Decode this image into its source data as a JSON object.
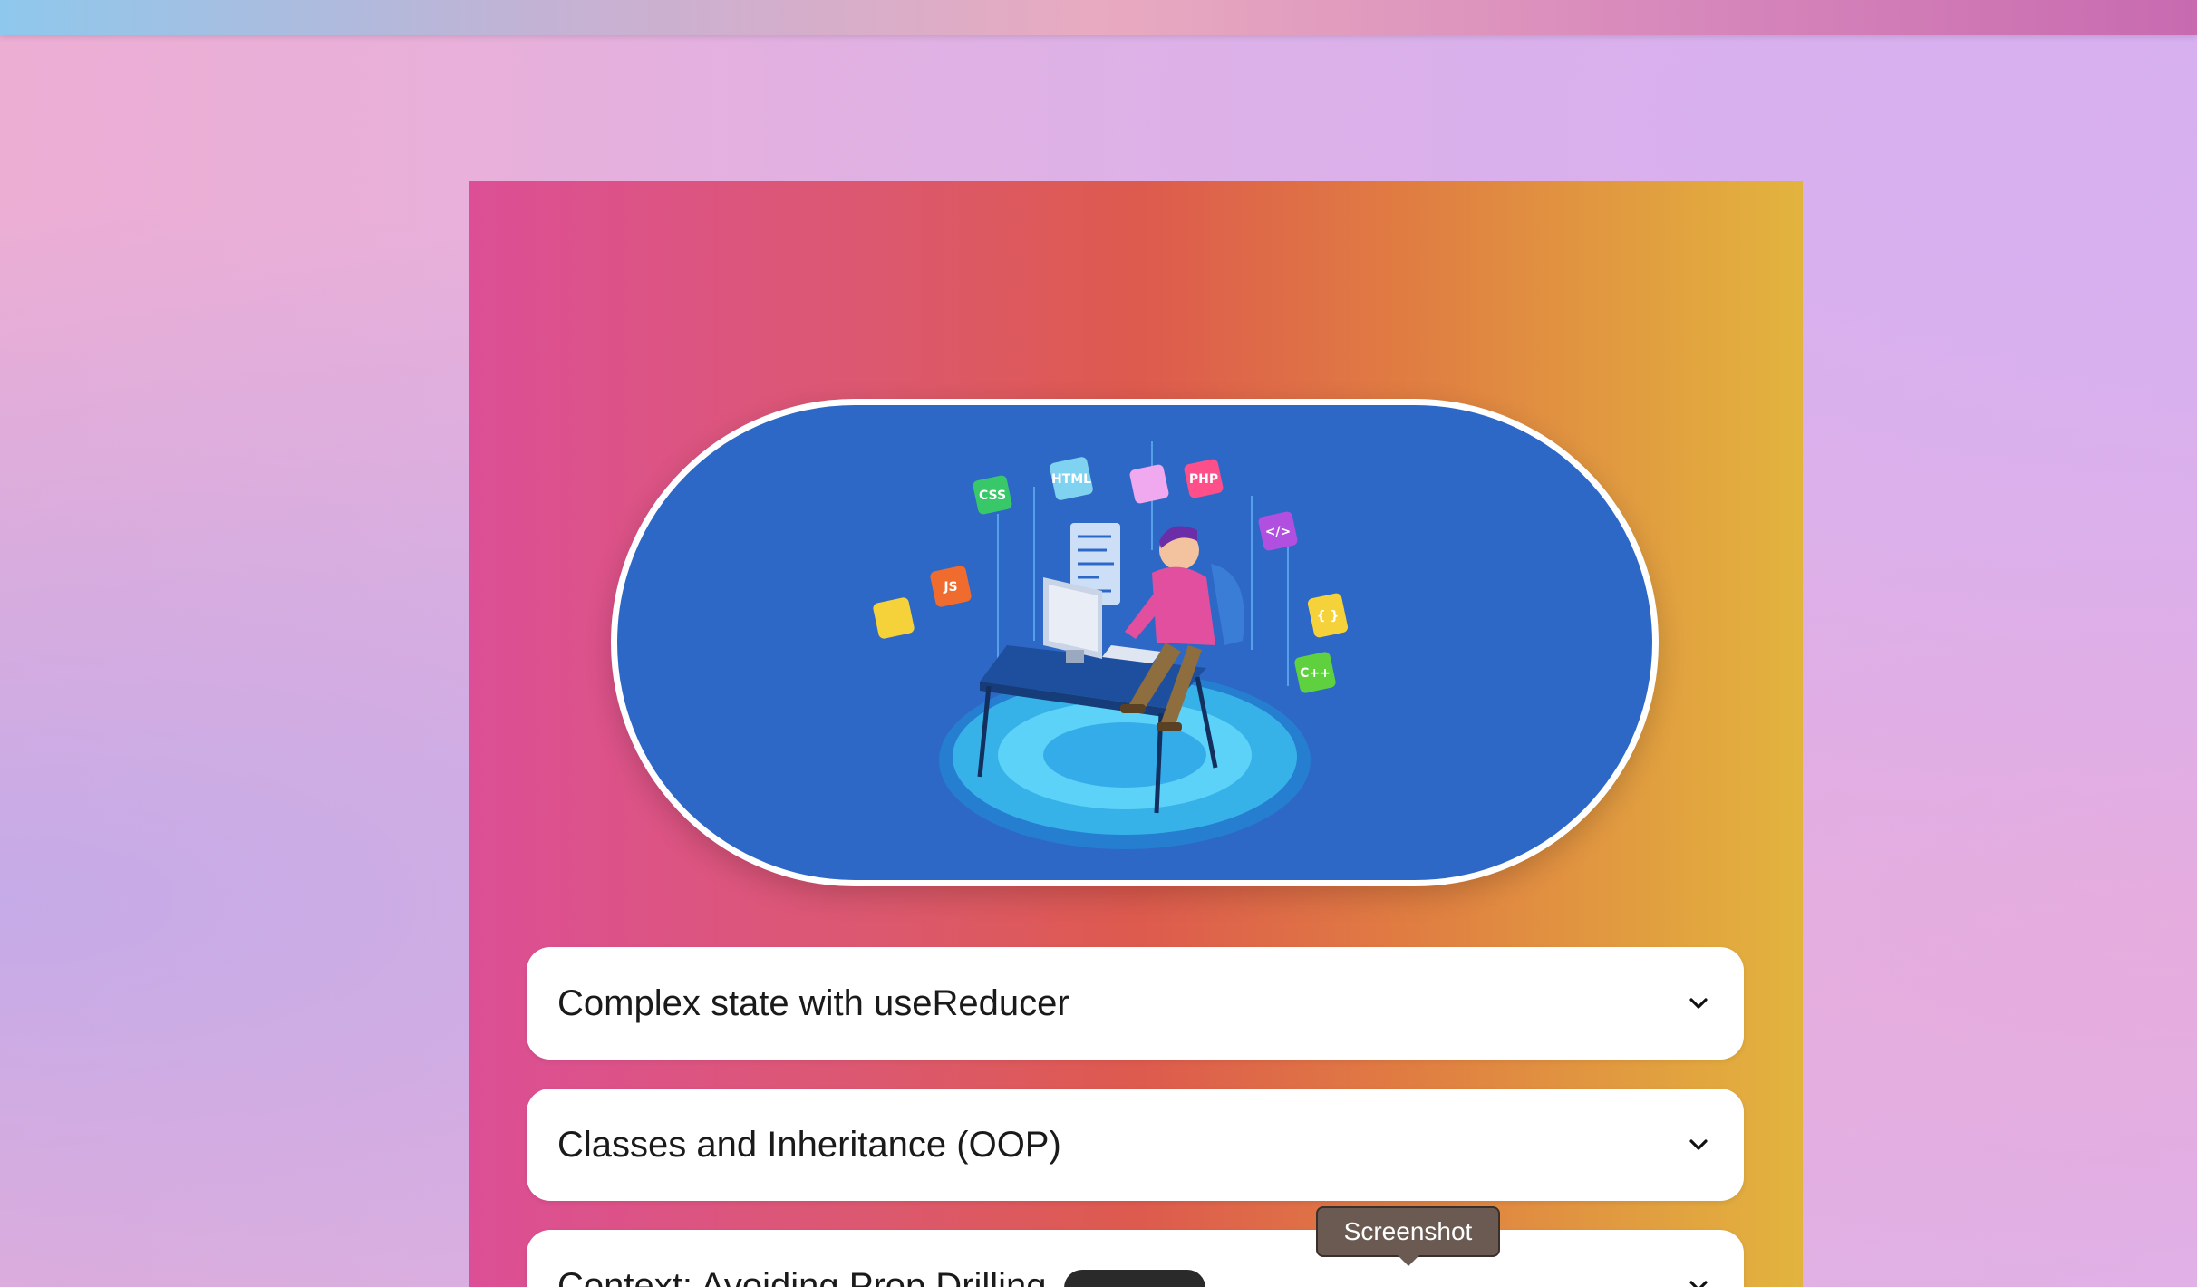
{
  "accordion": {
    "items": [
      {
        "title": "Complex state with useReducer"
      },
      {
        "title": "Classes and Inheritance (OOP)"
      },
      {
        "title": "Context: Avoiding Prop Drilling"
      }
    ]
  },
  "hero": {
    "tech_badges": [
      "CSS",
      "HTML",
      "PHP",
      "JS",
      "C++",
      "</>",
      "{ }"
    ]
  },
  "tooltip": {
    "label": "Screenshot"
  },
  "colors": {
    "panel_gradient": [
      "#dc4f96",
      "#dd5a4e",
      "#e2b43e"
    ],
    "hero_background": "#2e68c6",
    "card_background": "#ffffff",
    "tooltip_background": "#6a5a52"
  }
}
